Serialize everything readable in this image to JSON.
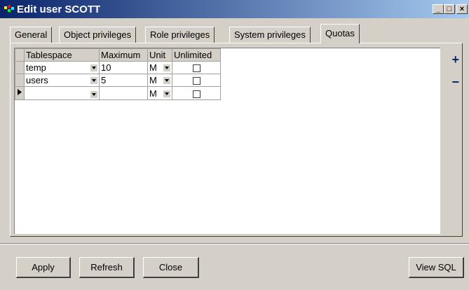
{
  "window": {
    "title": "Edit user SCOTT",
    "controls": {
      "minimize": "_",
      "maximize": "□",
      "close": "×"
    }
  },
  "tabs": [
    {
      "label": "General"
    },
    {
      "label": "Object privileges"
    },
    {
      "label": "Role privileges"
    },
    {
      "label": "System privileges"
    },
    {
      "label": "Quotas",
      "active": true
    }
  ],
  "grid": {
    "columns": [
      "Tablespace",
      "Maximum",
      "Unit",
      "Unlimited"
    ],
    "rows": [
      {
        "tablespace": "temp",
        "maximum": "10",
        "unit": "M",
        "unlimited": false
      },
      {
        "tablespace": "users",
        "maximum": "5",
        "unit": "M",
        "unlimited": false
      },
      {
        "tablespace": "",
        "maximum": "",
        "unit": "M",
        "unlimited": false,
        "current": true
      }
    ]
  },
  "side_buttons": {
    "add": "+",
    "remove": "−"
  },
  "buttons": {
    "apply": "Apply",
    "refresh": "Refresh",
    "close": "Close",
    "view_sql": "View SQL"
  },
  "colors": {
    "title_start": "#0a246a",
    "title_end": "#a6caf0",
    "face": "#d4d0c8"
  }
}
